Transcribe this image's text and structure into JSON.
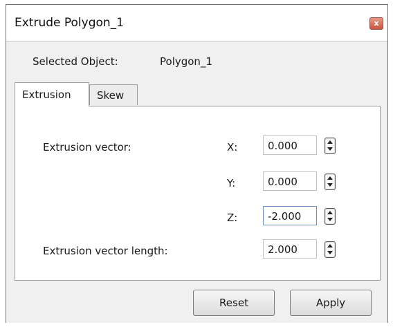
{
  "window": {
    "title": "Extrude Polygon_1",
    "close_glyph": "x"
  },
  "selected": {
    "label": "Selected Object:",
    "value": "Polygon_1"
  },
  "tabs": [
    {
      "label": "Extrusion",
      "active": true
    },
    {
      "label": "Skew",
      "active": false
    }
  ],
  "extrusion": {
    "vector_label": "Extrusion vector:",
    "fields": [
      {
        "axis": "X:",
        "value": "0.000"
      },
      {
        "axis": "Y:",
        "value": "0.000"
      },
      {
        "axis": "Z:",
        "value": "-2.000"
      }
    ],
    "length_label": "Extrusion vector length:",
    "length_value": "2.000"
  },
  "buttons": {
    "reset": "Reset",
    "apply": "Apply"
  },
  "icons": {
    "close": "close-icon",
    "spinner": "spin-arrows-icon"
  },
  "colors": {
    "close_button": "#c8553f",
    "focus_border": "#6a8fc2"
  }
}
